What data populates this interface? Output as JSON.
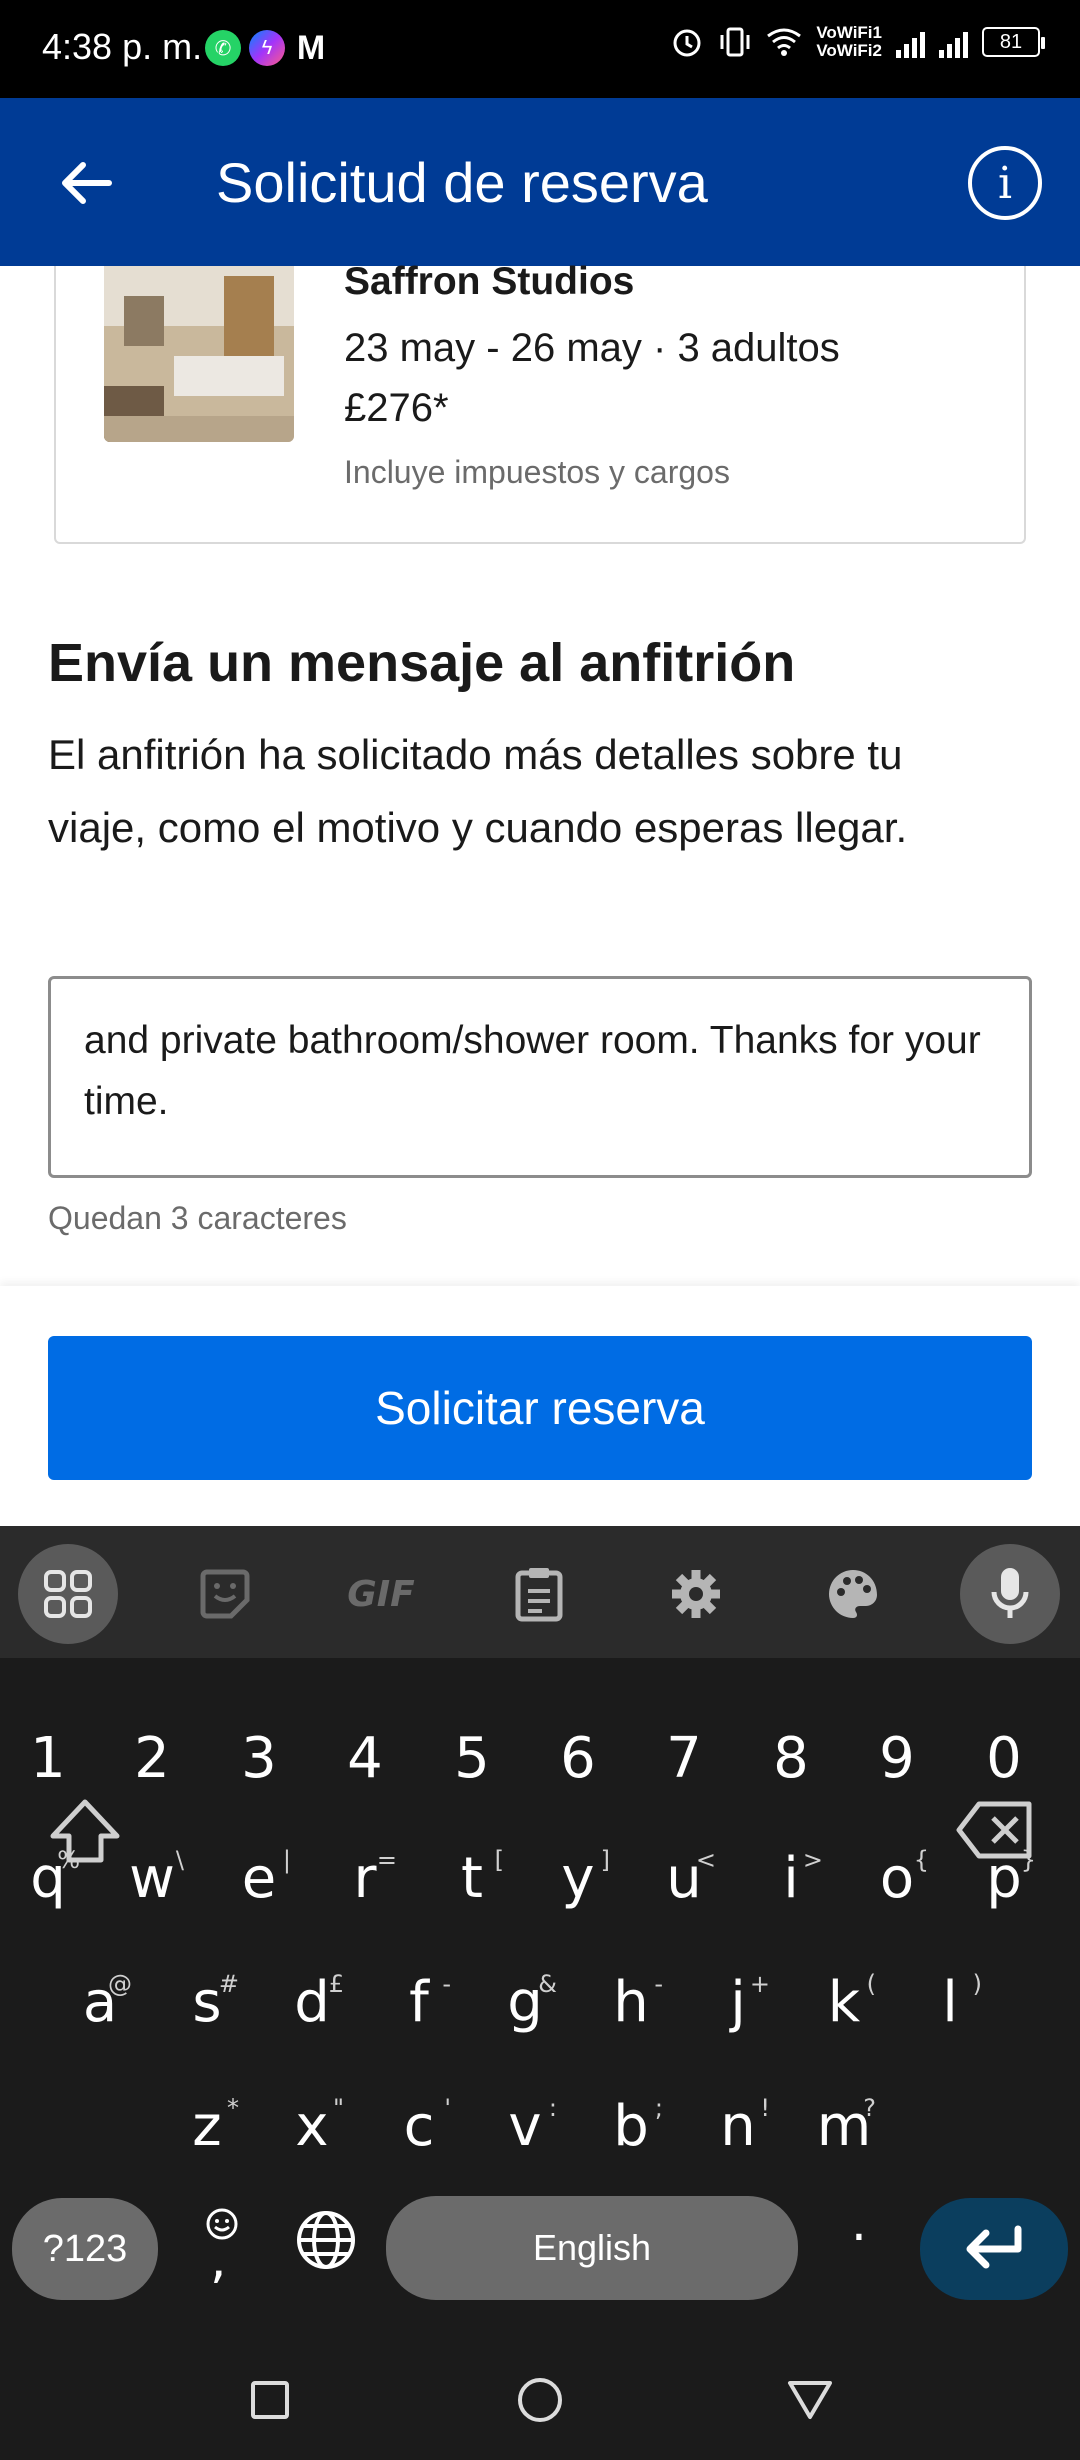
{
  "status_bar": {
    "time": "4:38 p. m.",
    "vowifi1": "VoWiFi1",
    "vowifi2": "VoWiFi2",
    "battery": "81",
    "icons": [
      "whatsapp-icon",
      "messenger-icon",
      "gmail-icon",
      "alarm-icon",
      "vibrate-icon",
      "wifi-icon",
      "signal-icon",
      "signal-icon",
      "battery-icon"
    ]
  },
  "app_bar": {
    "title": "Solicitud de reserva",
    "back_icon": "arrow-left-icon",
    "info_icon": "info-icon"
  },
  "property": {
    "name": "Saffron Studios",
    "dates": "23 may - 26 may · 3 adultos",
    "price": "£276*",
    "taxes_note": "Incluye impuestos y cargos"
  },
  "message": {
    "heading": "Envía un mensaje al anfitrión",
    "description": "El anfitrión ha solicitado más detalles sobre tu viaje, como el motivo y cuando esperas llegar.",
    "text_value": "and private bathroom/shower room. Thanks for your time.",
    "char_count": "Quedan 3 caracteres"
  },
  "action": {
    "request_button": "Solicitar reserva"
  },
  "keyboard": {
    "toolbar": [
      "apps-grid-icon",
      "sticker-icon",
      "GIF",
      "clipboard-icon",
      "settings-gear-icon",
      "palette-icon",
      "microphone-icon"
    ],
    "numbers": [
      "1",
      "2",
      "3",
      "4",
      "5",
      "6",
      "7",
      "8",
      "9",
      "0"
    ],
    "row1": [
      {
        "k": "q",
        "s": "%"
      },
      {
        "k": "w",
        "s": "\\"
      },
      {
        "k": "e",
        "s": "|"
      },
      {
        "k": "r",
        "s": "="
      },
      {
        "k": "t",
        "s": "["
      },
      {
        "k": "y",
        "s": "]"
      },
      {
        "k": "u",
        "s": "<"
      },
      {
        "k": "i",
        "s": ">"
      },
      {
        "k": "o",
        "s": "{"
      },
      {
        "k": "p",
        "s": "}"
      }
    ],
    "row2": [
      {
        "k": "a",
        "s": "@"
      },
      {
        "k": "s",
        "s": "#"
      },
      {
        "k": "d",
        "s": "£"
      },
      {
        "k": "f",
        "s": "-"
      },
      {
        "k": "g",
        "s": "&"
      },
      {
        "k": "h",
        "s": "-"
      },
      {
        "k": "j",
        "s": "+"
      },
      {
        "k": "k",
        "s": "("
      },
      {
        "k": "l",
        "s": ")"
      }
    ],
    "row3": [
      {
        "k": "z",
        "s": "*"
      },
      {
        "k": "x",
        "s": "\""
      },
      {
        "k": "c",
        "s": "'"
      },
      {
        "k": "v",
        "s": ":"
      },
      {
        "k": "b",
        "s": ";"
      },
      {
        "k": "n",
        "s": "!"
      },
      {
        "k": "m",
        "s": "?"
      }
    ],
    "symbols_key": "?123",
    "comma_key": ",",
    "space_key": "English",
    "period_key": "."
  },
  "nav_bar": {
    "items": [
      "recents-square-icon",
      "home-circle-icon",
      "back-triangle-icon"
    ]
  }
}
